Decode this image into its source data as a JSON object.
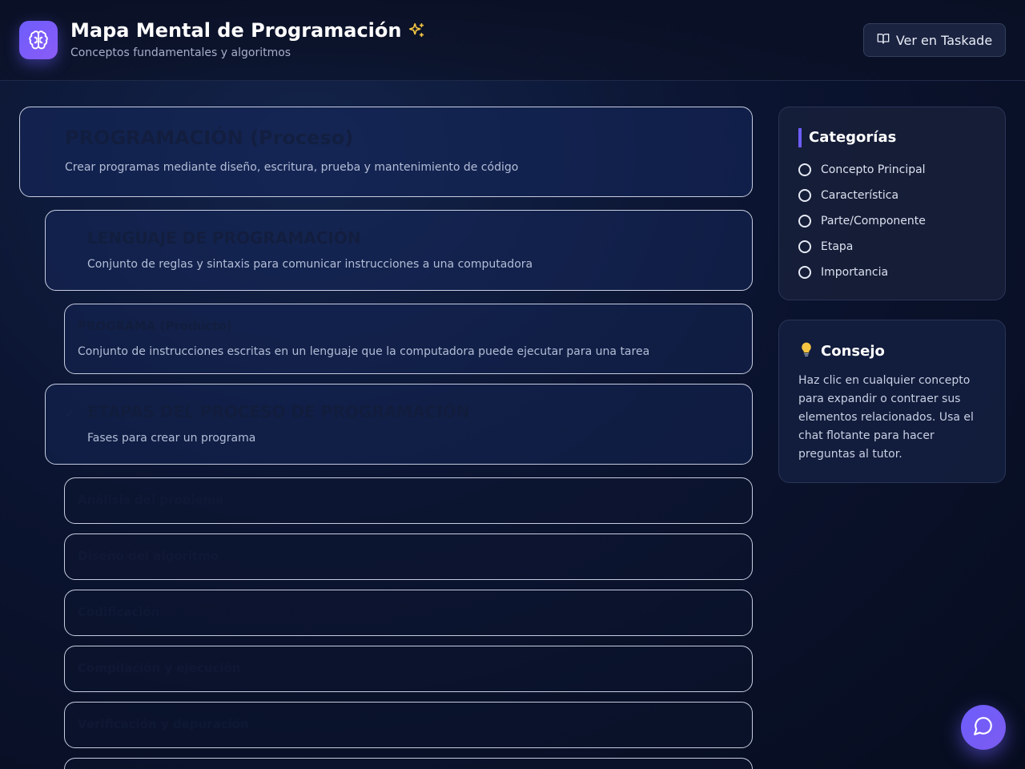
{
  "header": {
    "title": "Mapa Mental de Programación",
    "subtitle": "Conceptos fundamentales y algoritmos",
    "taskade_button": "Ver en Taskade",
    "logo_icon": "brain-icon",
    "title_icon": "sparkles-icon"
  },
  "nodes": [
    {
      "title": "PROGRAMACIÓN (Proceso)",
      "description": "Crear programas mediante diseño, escritura, prueba y mantenimiento de código"
    },
    {
      "title": "LENGUAJE DE PROGRAMACIÓN",
      "description": "Conjunto de reglas y sintaxis para comunicar instrucciones a una computadora"
    },
    {
      "title": "PROGRAMA (Producto)",
      "description": "Conjunto de instrucciones escritas en un lenguaje que la computadora puede ejecutar para una tarea"
    },
    {
      "title": "ETAPAS DEL PROCESO DE PROGRAMACIÓN",
      "description": "Fases para crear un programa"
    }
  ],
  "stages": [
    {
      "title": "Análisis del problema"
    },
    {
      "title": "Diseño del algoritmo"
    },
    {
      "title": "Codificación"
    },
    {
      "title": "Compilación y ejecución"
    },
    {
      "title": "Verificación y depuración"
    },
    {
      "title": ""
    }
  ],
  "categories": {
    "heading": "Categorías",
    "items": [
      "Concepto Principal",
      "Característica",
      "Parte/Componente",
      "Etapa",
      "Importancia"
    ]
  },
  "tip": {
    "heading": "Consejo",
    "icon": "lightbulb-icon",
    "text": "Haz clic en cualquier concepto para expandir o contraer sus elementos relacionados. Usa el chat flotante para hacer preguntas al tutor."
  },
  "colors": {
    "accent": "#6d5dfc",
    "background": "#0b1430",
    "card_border": "#c7cde0"
  }
}
